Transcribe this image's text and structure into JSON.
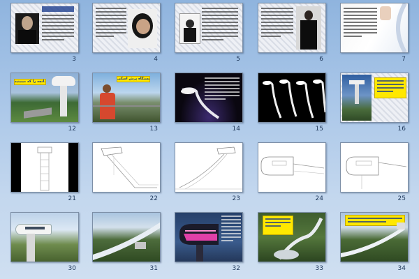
{
  "slides": [
    {
      "number": "3"
    },
    {
      "number": "4"
    },
    {
      "number": "5"
    },
    {
      "number": "6"
    },
    {
      "number": "7"
    },
    {
      "number": "12",
      "label": "آنچه را که میبینید..."
    },
    {
      "number": "13",
      "label": "ایستگاه پرش اسکی"
    },
    {
      "number": "14"
    },
    {
      "number": "15"
    },
    {
      "number": "16"
    },
    {
      "number": "21"
    },
    {
      "number": "22"
    },
    {
      "number": "23"
    },
    {
      "number": "24"
    },
    {
      "number": "25"
    },
    {
      "number": "30"
    },
    {
      "number": "31"
    },
    {
      "number": "32"
    },
    {
      "number": "33"
    },
    {
      "number": "34"
    }
  ],
  "colors": {
    "background_top": "#8fb4de",
    "background_bottom": "#cfdff1",
    "label_yellow": "#ffe800",
    "label_text": "#0a2d8f"
  }
}
